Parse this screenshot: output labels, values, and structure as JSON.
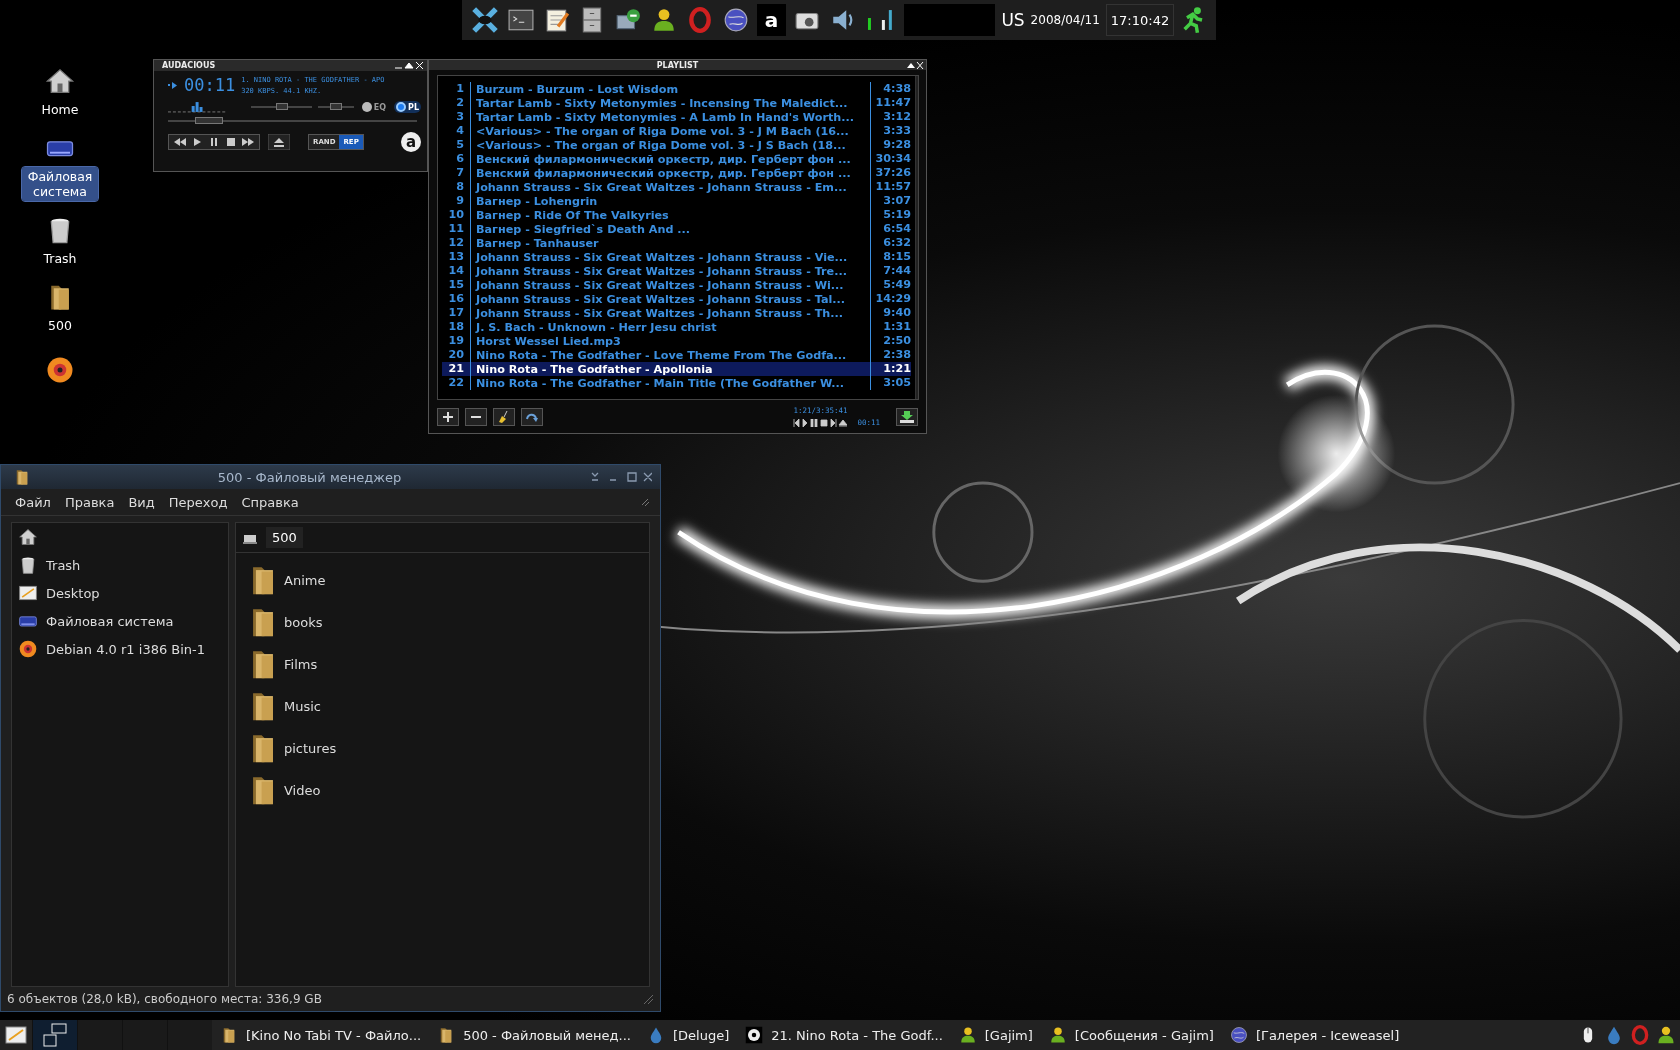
{
  "top_panel": {
    "launchers": [
      {
        "kind": "xfce"
      },
      {
        "kind": "terminal"
      },
      {
        "kind": "editor"
      },
      {
        "kind": "cabinet"
      },
      {
        "kind": "network"
      },
      {
        "kind": "person"
      },
      {
        "kind": "opera"
      },
      {
        "kind": "globe"
      },
      {
        "kind": "letter",
        "label": "a"
      },
      {
        "kind": "camera"
      },
      {
        "kind": "speaker"
      }
    ],
    "layout": "US",
    "date": "2008/04/11",
    "clock": "17:10:42"
  },
  "desktop_icons": [
    {
      "kind": "home",
      "label": "Home",
      "selected": false
    },
    {
      "kind": "drive",
      "label": "Файловая система",
      "selected": true
    },
    {
      "kind": "trash",
      "label": "Trash",
      "selected": false
    },
    {
      "kind": "folder",
      "label": "500",
      "selected": false
    },
    {
      "kind": "disc"
    }
  ],
  "audacious": {
    "title": "AUDACIOUS",
    "time": "00:11",
    "song": "1. NINO ROTA - THE GODFATHER - APO",
    "info": "320 KBPS. 44.1 KHZ.",
    "eq": {
      "label": "EQ",
      "on": false
    },
    "pl": {
      "label": "PL",
      "on": true
    },
    "volume": {
      "level": 0.5
    },
    "balance": {
      "level": 0.5
    },
    "seek": {
      "level": 0.12
    },
    "rand": {
      "label": "RAND",
      "on": false
    },
    "rep": {
      "label": "REP",
      "on": true
    },
    "logo": "a"
  },
  "playlist": {
    "title": "PLAYLIST",
    "tracks": [
      {
        "number": "1",
        "title": "Burzum - Burzum - Lost Wisdom",
        "duration": "4:38",
        "selected": false
      },
      {
        "number": "2",
        "title": "Tartar Lamb - Sixty Metonymies - Incensing The Maledict...",
        "duration": "11:47",
        "selected": false
      },
      {
        "number": "3",
        "title": "Tartar Lamb - Sixty Metonymies - A Lamb In Hand's Worth...",
        "duration": "3:12",
        "selected": false
      },
      {
        "number": "4",
        "title": "<Various> - The organ of Riga Dome vol. 3 - J M Bach (16...",
        "duration": "3:33",
        "selected": false
      },
      {
        "number": "5",
        "title": "<Various> - The organ of Riga Dome vol. 3 - J S Bach (18...",
        "duration": "9:28",
        "selected": false
      },
      {
        "number": "6",
        "title": "Венский филармонический оркестр, дир. Герберт фон ...",
        "duration": "30:34",
        "selected": false
      },
      {
        "number": "7",
        "title": "Венский филармонический оркестр, дир. Герберт фон ...",
        "duration": "37:26",
        "selected": false
      },
      {
        "number": "8",
        "title": "Johann Strauss - Six Great Waltzes - Johann Strauss - Em...",
        "duration": "11:57",
        "selected": false
      },
      {
        "number": "9",
        "title": "Вагнер - Lohengrin",
        "duration": "3:07",
        "selected": false
      },
      {
        "number": "10",
        "title": "Вагнер - Ride Of The Valkyries",
        "duration": "5:19",
        "selected": false
      },
      {
        "number": "11",
        "title": "Вагнер - Siegfried`s Death And ...",
        "duration": "6:54",
        "selected": false
      },
      {
        "number": "12",
        "title": "Вагнер - Tanhauser",
        "duration": "6:32",
        "selected": false
      },
      {
        "number": "13",
        "title": "Johann Strauss - Six Great Waltzes - Johann Strauss - Vie...",
        "duration": "8:15",
        "selected": false
      },
      {
        "number": "14",
        "title": "Johann Strauss - Six Great Waltzes - Johann Strauss - Tre...",
        "duration": "7:44",
        "selected": false
      },
      {
        "number": "15",
        "title": "Johann Strauss - Six Great Waltzes - Johann Strauss - Wi...",
        "duration": "5:49",
        "selected": false
      },
      {
        "number": "16",
        "title": "Johann Strauss - Six Great Waltzes - Johann Strauss - Tal...",
        "duration": "14:29",
        "selected": false
      },
      {
        "number": "17",
        "title": "Johann Strauss - Six Great Waltzes - Johann Strauss - Th...",
        "duration": "9:40",
        "selected": false
      },
      {
        "number": "18",
        "title": "J. S. Bach - Unknown - Herr Jesu christ",
        "duration": "1:31",
        "selected": false
      },
      {
        "number": "19",
        "title": "Horst Wessel Lied.mp3",
        "duration": "2:50",
        "selected": false
      },
      {
        "number": "20",
        "title": "Nino Rota - The Godfather - Love Theme From The Godfa...",
        "duration": "2:38",
        "selected": false
      },
      {
        "number": "21",
        "title": "Nino Rota - The Godfather - Apollonia",
        "duration": "1:21",
        "selected": true
      },
      {
        "number": "22",
        "title": "Nino Rota - The Godfather - Main Title (The Godfather W...",
        "duration": "3:05",
        "selected": false
      }
    ],
    "total": "1:21/3:35:41",
    "elapsed": "00:11"
  },
  "file_manager": {
    "title": "500 - Файловый менеджер",
    "menu": [
      "Файл",
      "Правка",
      "Вид",
      "Переход",
      "Справка"
    ],
    "places": [
      {
        "kind": "home"
      },
      {
        "kind": "trash",
        "label": "Trash"
      },
      {
        "kind": "desktop",
        "label": "Desktop"
      },
      {
        "kind": "drive",
        "label": "Файловая система"
      },
      {
        "kind": "disc",
        "label": "Debian 4.0 r1 i386 Bin-1"
      }
    ],
    "path": "500",
    "items": [
      "Anime",
      "books",
      "Films",
      "Music",
      "pictures",
      "Video"
    ],
    "status": "6 объектов (28,0 kB), свободного места: 336,9 GB"
  },
  "taskbar": {
    "workspaces": [
      {
        "selected": true
      },
      {
        "selected": false
      },
      {
        "selected": false
      },
      {
        "selected": false
      }
    ],
    "tasks": [
      {
        "kind": "folder",
        "label": "[Kino No Tabi TV - Файло..."
      },
      {
        "kind": "folder",
        "label": "500 - Файловый менед..."
      },
      {
        "kind": "drop",
        "label": "[Deluge]"
      },
      {
        "kind": "player",
        "label": "21. Nino Rota - The Godf..."
      },
      {
        "kind": "person",
        "label": "[Gajim]"
      },
      {
        "kind": "person",
        "label": "[Сообщения - Gajim]"
      },
      {
        "kind": "globe",
        "label": "[Галерея - Iceweasel]"
      }
    ],
    "tray": [
      {
        "kind": "mouse"
      },
      {
        "kind": "drop"
      },
      {
        "kind": "opera"
      },
      {
        "kind": "person"
      }
    ]
  }
}
